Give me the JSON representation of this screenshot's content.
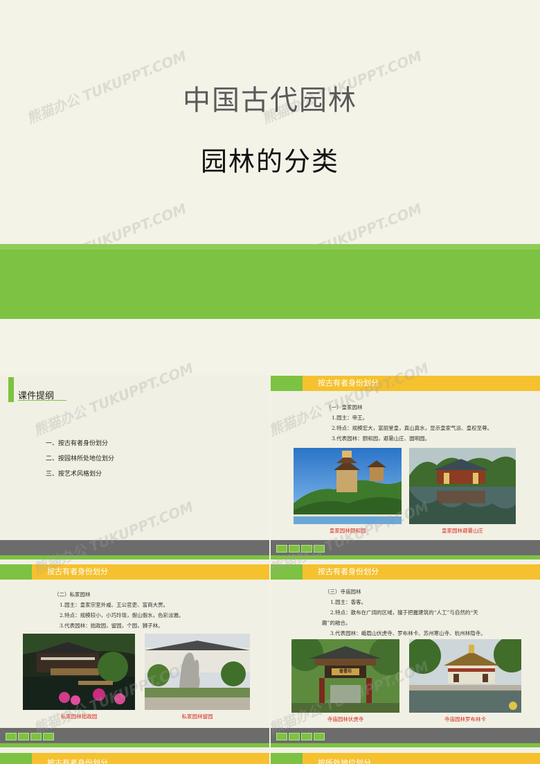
{
  "cover": {
    "title": "中国古代园林",
    "subtitle": "园林的分类"
  },
  "watermark": "熊猫办公 TUKUPPT.COM",
  "slide_outline": {
    "heading": "课件提纲",
    "items": [
      "一、按古有者身份划分",
      "二、按园林所处地位划分",
      "三、按艺术风格划分"
    ]
  },
  "slide_royal": {
    "header": "按古有者身份划分",
    "section": "（一）皇家园林",
    "lines": [
      "1.园主：帝王。",
      "2.特点：规模宏大，富丽堂皇，真山真水，显示皇家气派、皇权至尊。",
      "3.代表园林：颐和园，避暑山庄、圆明园。"
    ],
    "captions": [
      "皇家园林颐和园",
      "皇家园林避暑山庄"
    ]
  },
  "slide_private": {
    "header": "按古有者身份划分",
    "section": "（二）私家园林",
    "lines": [
      "1.园主：皇家宗室外戚、王公官吏、富商大贾。",
      "2.特点：规模较小，小巧玲珑，假山假水，色彩淡雅。",
      "3.代表园林：拙政园，留园，个园，狮子林。"
    ],
    "captions": [
      "私家园林拙政园",
      "私家园林留园"
    ]
  },
  "slide_temple": {
    "header": "按古有者身份划分",
    "section": "（三）寺庙园林",
    "lines": [
      "1.园主：香客。",
      "2.特点：散布在广阔的区域，擅于把握建筑的“人工”与自然的“天",
      "趣”的融合。",
      "3.代表园林：峨眉山伏虎寺、罗布林卡、苏州寒山寺、杭州林隐寺。"
    ],
    "captions": [
      "寺庙园林伏虎寺",
      "寺庙园林罗布林卡"
    ],
    "plaque": "香雪坊"
  },
  "slide_bottom_left": {
    "header": "按古有者身份划分"
  },
  "slide_bottom_right": {
    "header": "按所处地位划分"
  },
  "colors": {
    "green": "#7dc242",
    "yellow": "#f5c12e",
    "grey": "#6c6c6c",
    "caption_red": "#d9271e"
  }
}
